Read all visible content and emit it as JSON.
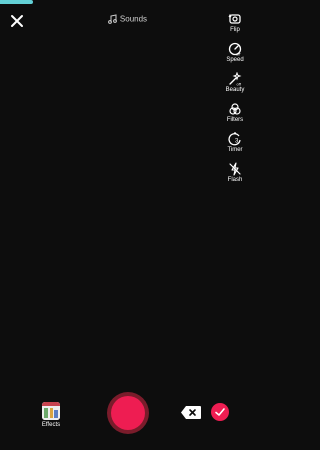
{
  "top": {
    "sounds_label": "Sounds",
    "progress_fraction": 0.13
  },
  "tools": [
    {
      "label": "Flip",
      "icon": "flip-camera-icon"
    },
    {
      "label": "Speed",
      "icon": "speed-icon"
    },
    {
      "label": "Beauty",
      "icon": "beauty-wand-icon"
    },
    {
      "label": "Filters",
      "icon": "filters-icon"
    },
    {
      "label": "Timer",
      "icon": "timer-icon"
    },
    {
      "label": "Flash",
      "icon": "flash-off-icon"
    }
  ],
  "bottom": {
    "effects_label": "Effects"
  },
  "colors": {
    "accent": "#ee1d52",
    "progress": "#63d0d6",
    "background": "#0d0d0d"
  }
}
